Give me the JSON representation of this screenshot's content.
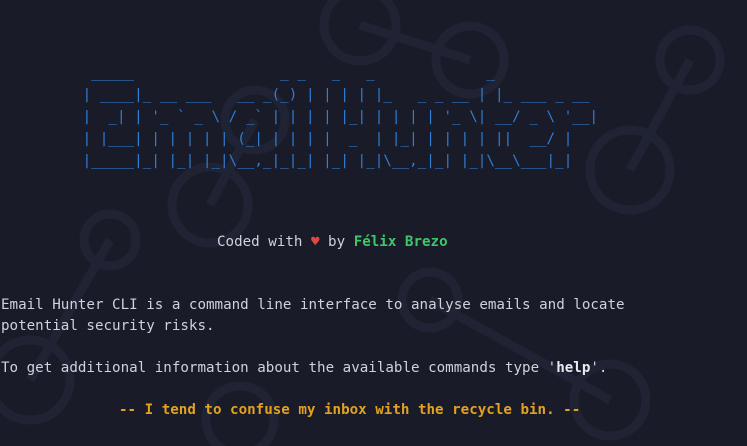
{
  "terminal": {
    "banner_lines": [
      "  _____                 _ _   _   _             _",
      " | ____|_ __ ___   __ _(_) | | | | |_   _ _ __ | |_ ___ _ __",
      " |  _| | '_ ` _ \\ / _` | | | | |_| | | | | '_ \\| __/ _ \\ '__|",
      " | |___| | | | | | (_| | | | |  _  | |_| | | | | ||  __/ |",
      " |_____|_| |_| |_|\\__,_|_|_| |_| |_|\\__,_|_| |_|\\__\\___|_|"
    ],
    "credits": {
      "prefix": "Coded with ",
      "heart": "♥",
      "by": " by ",
      "author": "Félix Brezo"
    },
    "description": {
      "line1": "Email Hunter CLI is a command line interface to analyse emails and locate",
      "line2": "potential security risks."
    },
    "info": {
      "prefix": "To get additional information about the available commands type '",
      "command": "help",
      "suffix": "'."
    },
    "quote": "-- I tend to confuse my inbox with the recycle bin. --"
  },
  "colors": {
    "background": "#191b28",
    "banner": "#2f7ed6",
    "heart": "#e04848",
    "author": "#3ec76a",
    "quote": "#e2a21f",
    "text": "#cfd2dc"
  }
}
